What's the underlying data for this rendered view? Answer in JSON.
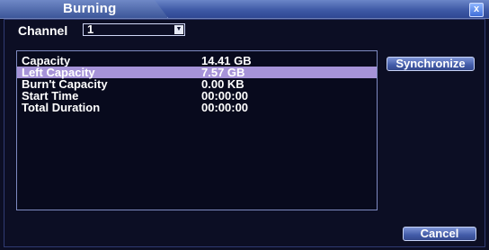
{
  "window": {
    "title": "Burning",
    "close_symbol": "x"
  },
  "channel": {
    "label": "Channel",
    "selected": "1",
    "arrow_icon": "chevron-down-icon"
  },
  "info": {
    "rows": [
      {
        "key": "Capacity",
        "value": "14.41 GB",
        "selected": false
      },
      {
        "key": "Left Capacity",
        "value": "7.57 GB",
        "selected": true
      },
      {
        "key": "Burn't Capacity",
        "value": "0.00 KB",
        "selected": false
      },
      {
        "key": "Start Time",
        "value": "00:00:00",
        "selected": false
      },
      {
        "key": "Total Duration",
        "value": "00:00:00",
        "selected": false
      }
    ]
  },
  "buttons": {
    "synchronize": "Synchronize",
    "cancel": "Cancel"
  },
  "colors": {
    "selection": "#a693d8",
    "titlebar": "#3f5aa6",
    "background": "#0c0e24"
  }
}
